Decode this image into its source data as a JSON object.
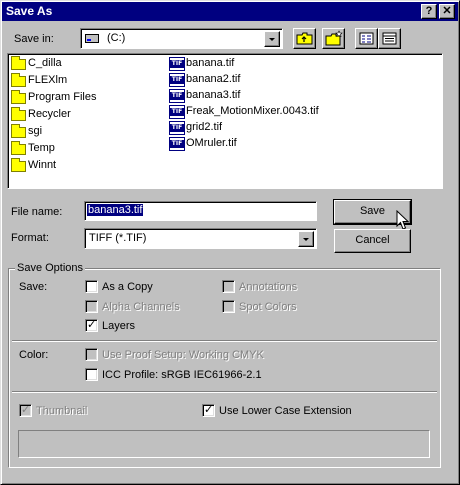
{
  "window": {
    "title": "Save As",
    "help_glyph": "?",
    "close_glyph": "✕"
  },
  "save_in": {
    "label": "Save in:",
    "value": "(C:)"
  },
  "files": {
    "folders": [
      "C_dilla",
      "FLEXlm",
      "Program Files",
      "Recycler",
      "sgi",
      "Temp",
      "Winnt"
    ],
    "tif_files": [
      "banana.tif",
      "banana2.tif",
      "banana3.tif",
      "Freak_MotionMixer.0043.tif",
      "grid2.tif",
      "OMruler.tif"
    ],
    "tif_badge": "TIF"
  },
  "file_name": {
    "label": "File name:",
    "value": "banana3.tif"
  },
  "format": {
    "label": "Format:",
    "value": "TIFF (*.TIF)"
  },
  "buttons": {
    "save": "Save",
    "cancel": "Cancel"
  },
  "save_options": {
    "group_label": "Save Options",
    "save_label": "Save:",
    "as_a_copy": {
      "label": "As a Copy",
      "checked": false,
      "enabled": true
    },
    "alpha_channels": {
      "label": "Alpha Channels",
      "checked": false,
      "enabled": false
    },
    "layers": {
      "label": "Layers",
      "checked": true,
      "enabled": true
    },
    "annotations": {
      "label": "Annotations",
      "checked": false,
      "enabled": false
    },
    "spot_colors": {
      "label": "Spot Colors",
      "checked": false,
      "enabled": false
    },
    "color_label": "Color:",
    "use_proof_setup": {
      "label": "Use Proof Setup:  Working CMYK",
      "checked": false,
      "enabled": false
    },
    "icc_profile": {
      "label": "ICC Profile:  sRGB IEC61966-2.1",
      "checked": false,
      "enabled": true
    },
    "thumbnail": {
      "label": "Thumbnail",
      "checked": true,
      "enabled": false
    },
    "use_lower_case_extension": {
      "label": "Use Lower Case Extension",
      "checked": true,
      "enabled": true
    }
  },
  "colors": {
    "title_bar": "#000080",
    "face": "#c0c0c0",
    "disabled_text": "#808080"
  }
}
